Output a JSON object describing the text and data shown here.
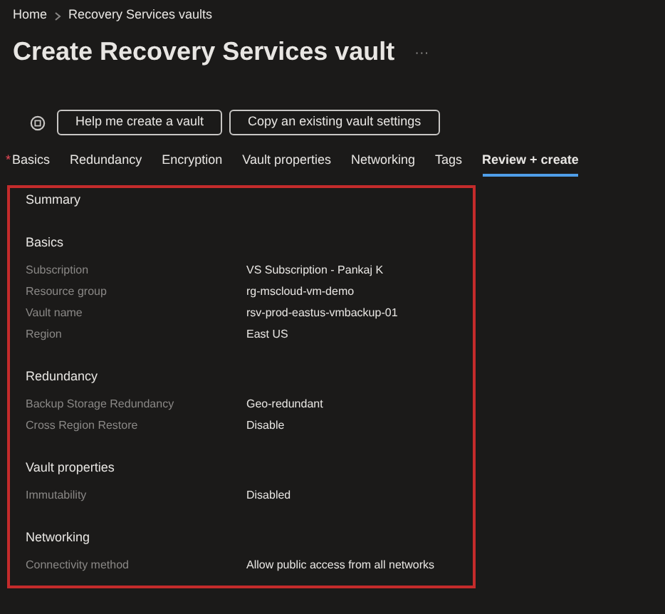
{
  "breadcrumb": [
    {
      "label": "Home"
    },
    {
      "label": "Recovery Services vaults"
    }
  ],
  "title": "Create Recovery Services vault",
  "more_menu": "···",
  "actions": [
    {
      "label": "Help me create a vault"
    },
    {
      "label": "Copy an existing vault settings"
    }
  ],
  "tabs": [
    {
      "label": "Basics",
      "required_mark": "*",
      "selected": false
    },
    {
      "label": "Redundancy",
      "selected": false
    },
    {
      "label": "Encryption",
      "selected": false
    },
    {
      "label": "Vault properties",
      "selected": false
    },
    {
      "label": "Networking",
      "selected": false
    },
    {
      "label": "Tags",
      "selected": false
    },
    {
      "label": "Review + create",
      "selected": true
    }
  ],
  "summary": {
    "title": "Summary",
    "sections": [
      {
        "heading": "Basics",
        "rows": [
          {
            "label": "Subscription",
            "value": "VS Subscription - Pankaj K"
          },
          {
            "label": "Resource group",
            "value": "rg-mscloud-vm-demo"
          },
          {
            "label": "Vault name",
            "value": "rsv-prod-eastus-vmbackup-01"
          },
          {
            "label": "Region",
            "value": "East US"
          }
        ]
      },
      {
        "heading": "Redundancy",
        "rows": [
          {
            "label": "Backup Storage Redundancy",
            "value": "Geo-redundant"
          },
          {
            "label": "Cross Region Restore",
            "value": "Disable"
          }
        ]
      },
      {
        "heading": "Vault properties",
        "rows": [
          {
            "label": "Immutability",
            "value": "Disabled"
          }
        ]
      },
      {
        "heading": "Networking",
        "rows": [
          {
            "label": "Connectivity method",
            "value": "Allow public access from all networks"
          }
        ]
      }
    ]
  }
}
